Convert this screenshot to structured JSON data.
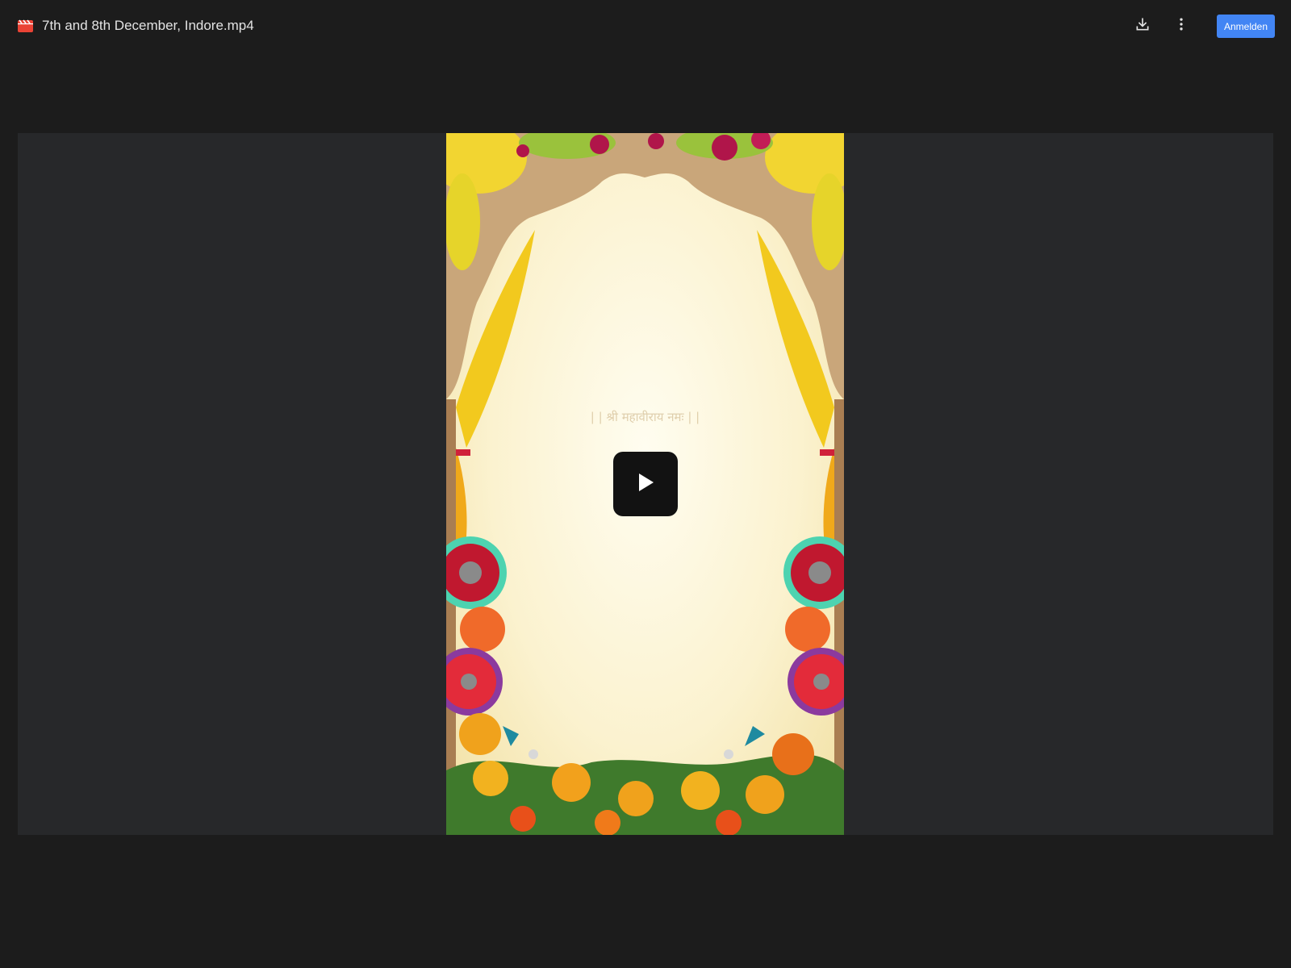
{
  "header": {
    "file_icon": "video-file-icon",
    "file_name": "7th and 8th December, Indore.mp4",
    "download_icon": "download-icon",
    "more_icon": "more-vertical-icon",
    "signin_label": "Anmelden"
  },
  "player": {
    "play_icon": "play-icon",
    "frame_text": "| | श्री महावीराय नमः | |"
  },
  "colors": {
    "background": "#1c1c1c",
    "player_background": "#27282a",
    "accent": "#4285f4",
    "file_icon": "#ea4335"
  }
}
